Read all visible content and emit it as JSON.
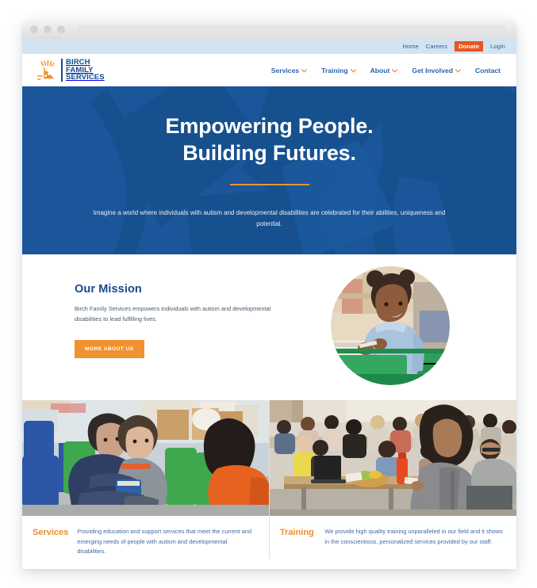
{
  "browser": {
    "dots": [
      "close-dot",
      "minimize-dot",
      "maximize-dot"
    ],
    "url_value": ""
  },
  "utility_nav": {
    "items": [
      {
        "label": "Home",
        "style": "plain"
      },
      {
        "label": "Careers",
        "style": "plain"
      },
      {
        "label": "Donate",
        "style": "highlight"
      },
      {
        "label": "Login",
        "style": "plain"
      }
    ],
    "highlight_color": "#e8551f",
    "bar_color": "#d3e3ef"
  },
  "header": {
    "logo": {
      "icon": "sunburst-icon",
      "line1": "BIRCH",
      "line2": "FAMILY",
      "line3": "SERVICES",
      "text_color": "#134a8e",
      "icon_color": "#f0922e"
    },
    "nav": [
      {
        "label": "Services",
        "has_dropdown": true
      },
      {
        "label": "Training",
        "has_dropdown": true
      },
      {
        "label": "About",
        "has_dropdown": true
      },
      {
        "label": "Get Involved",
        "has_dropdown": true
      },
      {
        "label": "Contact",
        "has_dropdown": false
      }
    ],
    "nav_color": "#2a64ae"
  },
  "hero": {
    "title_line1": "Empowering People.",
    "title_line2": "Building Futures.",
    "subtitle": "Imagine a world where individuals with autism and developmental disabilities are celebrated for their abilities, uniqueness and potential.",
    "background_color": "#1a5699",
    "rule_color": "#e99339"
  },
  "mission": {
    "title": "Our Mission",
    "body": "Birch Family Services empowers individuals with autism and developmental disabilities to lead fulfilling lives.",
    "button_label": "MORE ABOUT US",
    "button_color": "#f0922e",
    "photo_alt": "smiling-child-at-table-photo"
  },
  "cards": [
    {
      "title": "Services",
      "description": "Providing education and support services that meet the current and emerging needs of people with autism and developmental disabilities.",
      "photo_alt": "two-children-hugging-in-classroom-photo"
    },
    {
      "title": "Training",
      "description": "We provide high quality training unparalleled in our field and it shows in the conscientious, personalized services provided by our staff.",
      "photo_alt": "trainer-speaking-to-seated-audience-photo"
    }
  ],
  "colors": {
    "brand_blue": "#134a8e",
    "hero_blue": "#1a5699",
    "accent_orange": "#f0922e",
    "donate_orange": "#e8551f",
    "card_text_blue": "#3f6aa8"
  }
}
